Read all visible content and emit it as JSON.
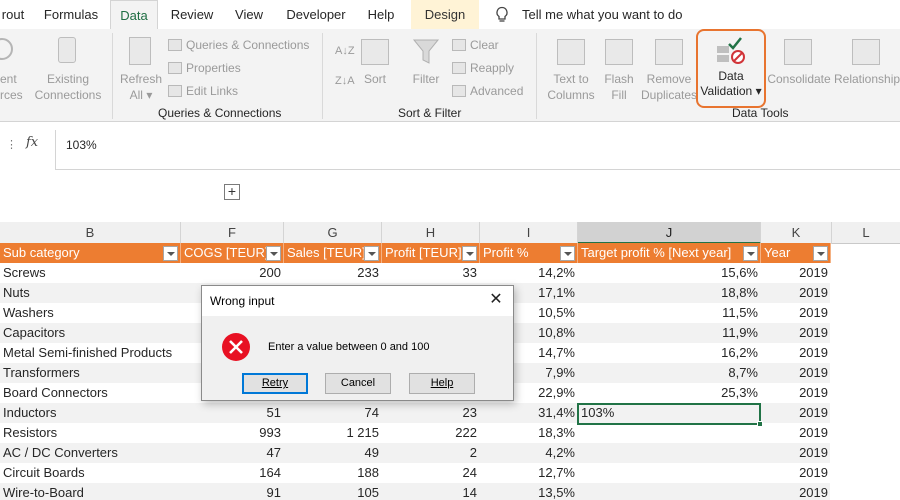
{
  "ribbon": {
    "tabs": [
      {
        "label": "rout",
        "active": false
      },
      {
        "label": "Formulas",
        "active": false
      },
      {
        "label": "Data",
        "active": true
      },
      {
        "label": "Review",
        "active": false
      },
      {
        "label": "View",
        "active": false
      },
      {
        "label": "Developer",
        "active": false
      },
      {
        "label": "Help",
        "active": false
      },
      {
        "label": "Design",
        "active": false
      }
    ],
    "tell_me": "Tell me what you want to do",
    "get_data": {
      "recent_sources_line1": "ent",
      "recent_sources_line2": "rces",
      "existing_connections_line1": "Existing",
      "existing_connections_line2": "Connections"
    },
    "queries": {
      "refresh_all_line1": "Refresh",
      "refresh_all_line2": "All",
      "queries_connections": "Queries & Connections",
      "properties": "Properties",
      "edit_links": "Edit Links",
      "group_label": "Queries & Connections"
    },
    "sort_filter": {
      "sort": "Sort",
      "filter": "Filter",
      "clear": "Clear",
      "reapply": "Reapply",
      "advanced": "Advanced",
      "group_label": "Sort & Filter"
    },
    "data_tools": {
      "text_to_columns_line1": "Text to",
      "text_to_columns_line2": "Columns",
      "flash_fill_line1": "Flash",
      "flash_fill_line2": "Fill",
      "remove_duplicates_line1": "Remove",
      "remove_duplicates_line2": "Duplicates",
      "data_validation_line1": "Data",
      "data_validation_line2": "Validation",
      "consolidate": "Consolidate",
      "relationships": "Relationship",
      "group_label": "Data Tools"
    },
    "accent_color": "#e8742f"
  },
  "formula_bar": {
    "fx": "fx",
    "value": "103%"
  },
  "outline": {
    "expand_symbol": "+"
  },
  "grid": {
    "columns": [
      "B",
      "F",
      "G",
      "H",
      "I",
      "J",
      "K",
      "L"
    ],
    "selected_column": "J",
    "header_color": "#ed7d31",
    "headers": [
      "Sub category",
      "COGS [TEUR]",
      "Sales [TEUR]",
      "Profit [TEUR]",
      "Profit %",
      "Target profit % [Next year]",
      "Year"
    ],
    "rows": [
      {
        "sub": "Screws",
        "cogs": "200",
        "sales": "233",
        "profit": "33",
        "pct": "14,2%",
        "target": "15,6%",
        "year": "2019"
      },
      {
        "sub": "Nuts",
        "cogs": "",
        "sales": "",
        "profit": "",
        "pct": "17,1%",
        "target": "18,8%",
        "year": "2019"
      },
      {
        "sub": "Washers",
        "cogs": "",
        "sales": "",
        "profit": "",
        "pct": "10,5%",
        "target": "11,5%",
        "year": "2019"
      },
      {
        "sub": "Capacitors",
        "cogs": "",
        "sales": "",
        "profit": "",
        "pct": "10,8%",
        "target": "11,9%",
        "year": "2019"
      },
      {
        "sub": "Metal Semi-finished Products",
        "cogs": "",
        "sales": "",
        "profit": "",
        "pct": "14,7%",
        "target": "16,2%",
        "year": "2019"
      },
      {
        "sub": "Transformers",
        "cogs": "",
        "sales": "",
        "profit": "",
        "pct": "7,9%",
        "target": "8,7%",
        "year": "2019"
      },
      {
        "sub": "Board Connectors",
        "cogs": "",
        "sales": "",
        "profit": "",
        "pct": "22,9%",
        "target": "25,3%",
        "year": "2019"
      },
      {
        "sub": "Inductors",
        "cogs": "51",
        "sales": "74",
        "profit": "23",
        "pct": "31,4%",
        "target": "103%",
        "year": "2019"
      },
      {
        "sub": "Resistors",
        "cogs": "993",
        "sales": "1 215",
        "profit": "222",
        "pct": "18,3%",
        "target": "",
        "year": "2019"
      },
      {
        "sub": "AC / DC Converters",
        "cogs": "47",
        "sales": "49",
        "profit": "2",
        "pct": "4,2%",
        "target": "",
        "year": "2019"
      },
      {
        "sub": "Circuit Boards",
        "cogs": "164",
        "sales": "188",
        "profit": "24",
        "pct": "12,7%",
        "target": "",
        "year": "2019"
      },
      {
        "sub": "Wire-to-Board",
        "cogs": "91",
        "sales": "105",
        "profit": "14",
        "pct": "13,5%",
        "target": "",
        "year": "2019"
      }
    ]
  },
  "dialog": {
    "title": "Wrong input",
    "close": "✕",
    "message": "Enter a value between 0 and 100",
    "retry": "Retry",
    "cancel": "Cancel",
    "help": "Help",
    "error_color": "#e81123"
  }
}
